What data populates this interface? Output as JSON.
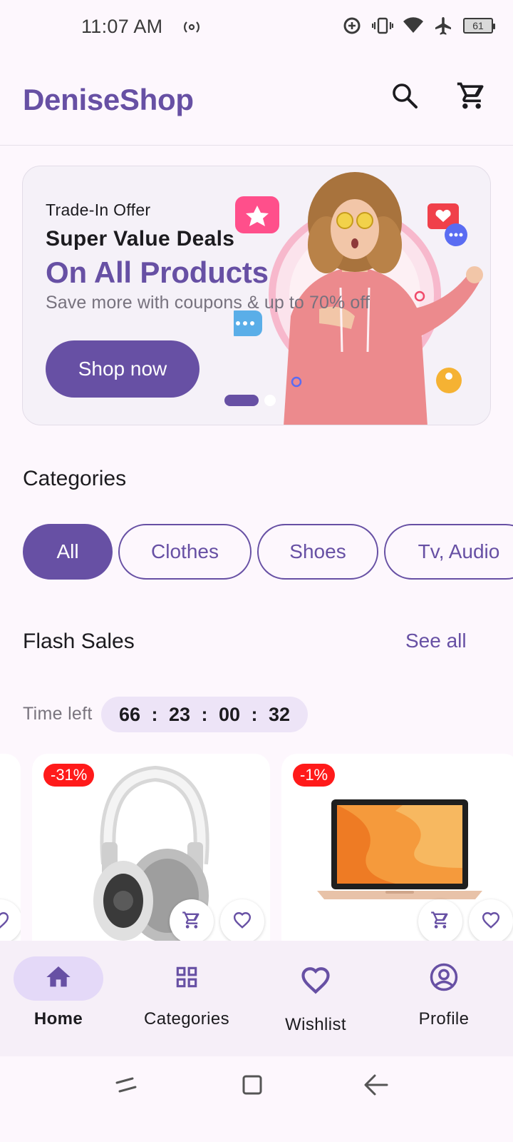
{
  "status_bar": {
    "time": "11:07 AM",
    "battery": "61",
    "icons": [
      "hotspot-icon",
      "data-saver-icon",
      "vibrate-icon",
      "wifi-icon",
      "airplane-icon",
      "battery-icon"
    ]
  },
  "app_bar": {
    "title": "DeniseShop",
    "search_icon": "search-icon",
    "cart_icon": "cart-icon"
  },
  "banner": {
    "kicker": "Trade-In Offer",
    "heading": "Super Value Deals",
    "highlight": "On All Products",
    "subtitle": "Save more with coupons & up to 70% off",
    "button_label": "Shop now",
    "slides_total": 2,
    "slide_active": 1
  },
  "categories": {
    "title": "Categories",
    "chips": [
      "All",
      "Clothes",
      "Shoes",
      "Tv, Audio"
    ],
    "selected": "All"
  },
  "flash_sales": {
    "title": "Flash Sales",
    "see_all": "See all",
    "time_label": "Time left",
    "timer": [
      "66",
      "23",
      "00",
      "32"
    ],
    "products": [
      {
        "discount": "-31%",
        "image": "headphones"
      },
      {
        "discount": "-1%",
        "image": "laptop"
      }
    ]
  },
  "bottom_nav": {
    "items": [
      {
        "label": "Home",
        "icon": "home-icon"
      },
      {
        "label": "Categories",
        "icon": "grid-icon"
      },
      {
        "label": "Wishlist",
        "icon": "heart-icon"
      },
      {
        "label": "Profile",
        "icon": "profile-icon"
      }
    ],
    "active": "Home"
  },
  "colors": {
    "primary": "#6750a4",
    "background": "#fdf7fd",
    "discount": "#ff1a1a",
    "timer_bg": "#ede4f7"
  }
}
